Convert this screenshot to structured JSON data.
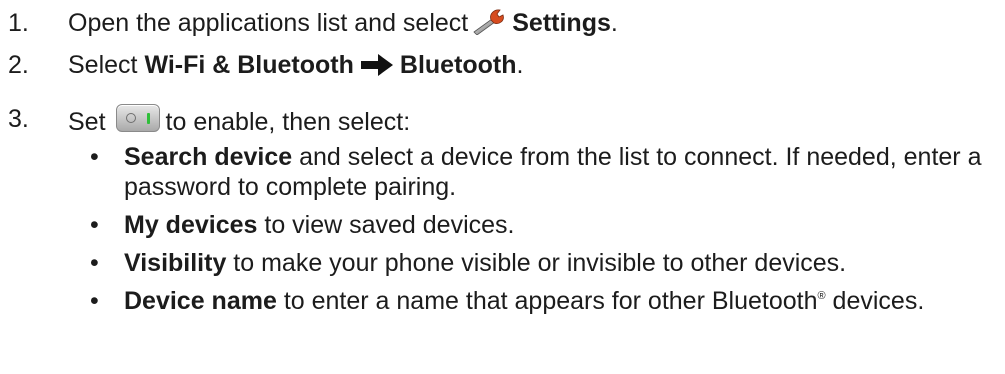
{
  "steps": [
    {
      "number": "1.",
      "text_before": "Open the applications list and select",
      "icon": "wrench-icon",
      "bold": "Settings",
      "text_after": "."
    },
    {
      "number": "2.",
      "text_before": "Select",
      "bold_1": "Wi-Fi & Bluetooth",
      "arrow_icon": "right-arrow-icon",
      "bold_2": "Bluetooth",
      "text_after": "."
    },
    {
      "number": "3.",
      "text_before": "Set",
      "icon": "toggle-switch-icon",
      "text_after": "to enable, then select:"
    }
  ],
  "bullets": [
    {
      "bold": "Search device",
      "text": " and select a device from the list to connect. If needed, enter a password to complete pairing."
    },
    {
      "bold": "My devices",
      "text": " to view saved devices."
    },
    {
      "bold": "Visibility",
      "text": " to make your phone visible or invisible to other devices."
    },
    {
      "bold": "Device name",
      "text": " to enter a name that appears for other Bluetooth",
      "sup": "®",
      "text_end": " devices."
    }
  ],
  "bullet_glyph": "•"
}
